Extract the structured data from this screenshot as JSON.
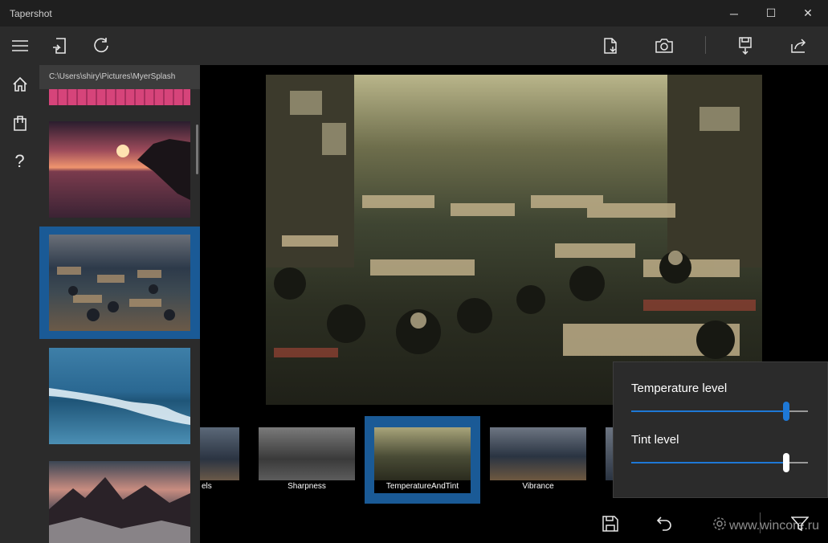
{
  "app": {
    "title": "Tapershot"
  },
  "window_controls": {
    "minimize": "─",
    "maximize": "☐",
    "close": "✕"
  },
  "rail": [
    {
      "name": "hamburger-menu-icon"
    },
    {
      "name": "home-icon"
    },
    {
      "name": "store-bag-icon"
    },
    {
      "name": "help-icon",
      "glyph": "?"
    }
  ],
  "toolbar": {
    "left": [
      "open-file-icon",
      "rotate-icon"
    ],
    "right": [
      "export-file-icon",
      "camera-icon",
      "save-download-icon",
      "share-icon"
    ]
  },
  "panel": {
    "path": "C:\\Users\\shiry\\Pictures\\MyerSplash",
    "thumbnails": [
      "pink-pattern",
      "sunset-sea",
      "crowded-street",
      "ocean-wave",
      "mountain-sunset"
    ],
    "selected_index": 2
  },
  "filters": [
    {
      "label": "els"
    },
    {
      "label": "Sharpness"
    },
    {
      "label": "TemperatureAndTint",
      "selected": true
    },
    {
      "label": "Vibrance"
    },
    {
      "label": ""
    }
  ],
  "flyout": {
    "temperature_label": "Temperature level",
    "temperature_value": 0.89,
    "tint_label": "Tint level",
    "tint_value": 0.89
  },
  "bottom_bar": [
    "save-icon",
    "undo-icon",
    "settings-icon",
    "filter-icon"
  ],
  "watermark": "www.wincore.ru",
  "colors": {
    "accent": "#1e78d6",
    "selection": "#1a5a96",
    "chrome": "#2b2b2b"
  }
}
